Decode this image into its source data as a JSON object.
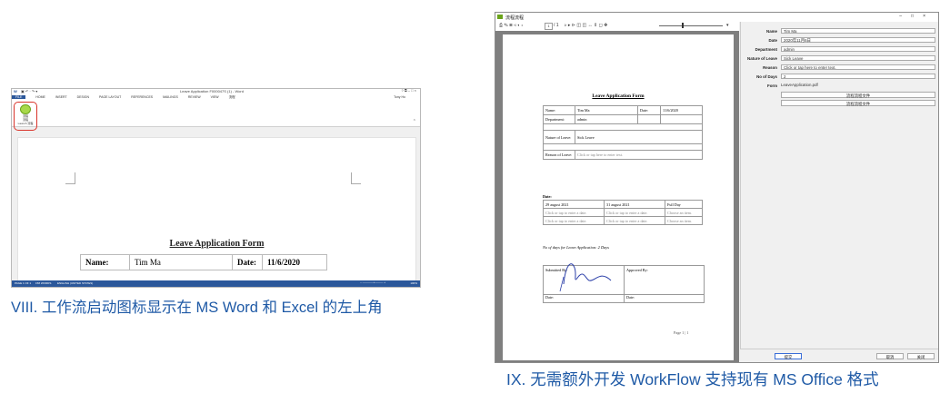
{
  "word": {
    "title": "Leave Application F000047S (1) - Word",
    "user": "Tony Ho",
    "tabs": [
      "FILE",
      "HOME",
      "INSERT",
      "DESIGN",
      "PAGE LAYOUT",
      "REFERENCES",
      "MAILINGS",
      "REVIEW",
      "VIEW",
      "流程"
    ],
    "ribbon_button": {
      "line1": "流程",
      "line2": "流程",
      "group": "Launch 流程"
    },
    "doc_title": "Leave Application Form",
    "row": {
      "name_label": "Name:",
      "name_value": "Tim Ma",
      "date_label": "Date:",
      "date_value": "11/6/2020"
    },
    "status": {
      "page": "PAGE 1 OF 1",
      "words": "158 WORDS",
      "language": "ENGLISH (UNITED STATES)",
      "zoom": "100%"
    }
  },
  "caption_left": "VIII. 工作流启动图标显示在 MS Word 和 Excel 的左上角",
  "viewer": {
    "title": "流程流程",
    "page_num": "1",
    "page_total": "/ 1",
    "doc": {
      "title": "Leave Application Form",
      "name_label": "Name:",
      "name_value": "Tim Ma",
      "date_label": "Date:",
      "date_value": "11/6/2020",
      "dept_label": "Department:",
      "dept_value": "admin",
      "nature_label": "Nature of Leave:",
      "nature_value": "Sick Leave",
      "reason_label": "Reason of Leave:",
      "reason_value": "Click or tap here to enter text.",
      "dates_header": "Date:",
      "date_rows": [
        [
          "29 august 2021",
          "31 august 2021",
          "Full Day"
        ],
        [
          "Click or tap to enter a date.",
          "Click or tap to enter a date.",
          "Choose an item."
        ],
        [
          "Click or tap to enter a date.",
          "Click or tap to enter a date.",
          "Choose an item."
        ]
      ],
      "days_line": "No of days for Leave Application: 2 Days",
      "submitted_label": "Submitted By:",
      "approved_label": "Approved By:",
      "sig_date1": "Date:",
      "sig_date2": "Date:",
      "footer": "Page 1 | 1"
    },
    "form": {
      "fields": [
        {
          "label": "Name",
          "value": "Tim Ma"
        },
        {
          "label": "Date",
          "value": "2020年11月6日"
        },
        {
          "label": "Department",
          "value": "admin"
        },
        {
          "label": "Nature of Leave",
          "value": "Sick Leave"
        },
        {
          "label": "Reason",
          "value": "Click or tap here to enter text."
        },
        {
          "label": "No of Days",
          "value": "2"
        },
        {
          "label": "Form",
          "value": "LeaveApplication.pdf"
        }
      ],
      "btn1": "流程流程文件",
      "btn2": "流程流程文件",
      "bottom_left": "提交",
      "bottom_mid": "取消",
      "bottom_right": "关闭"
    }
  },
  "caption_right": "IX. 无需额外开发 WorkFlow 支持现有 MS Office 格式"
}
